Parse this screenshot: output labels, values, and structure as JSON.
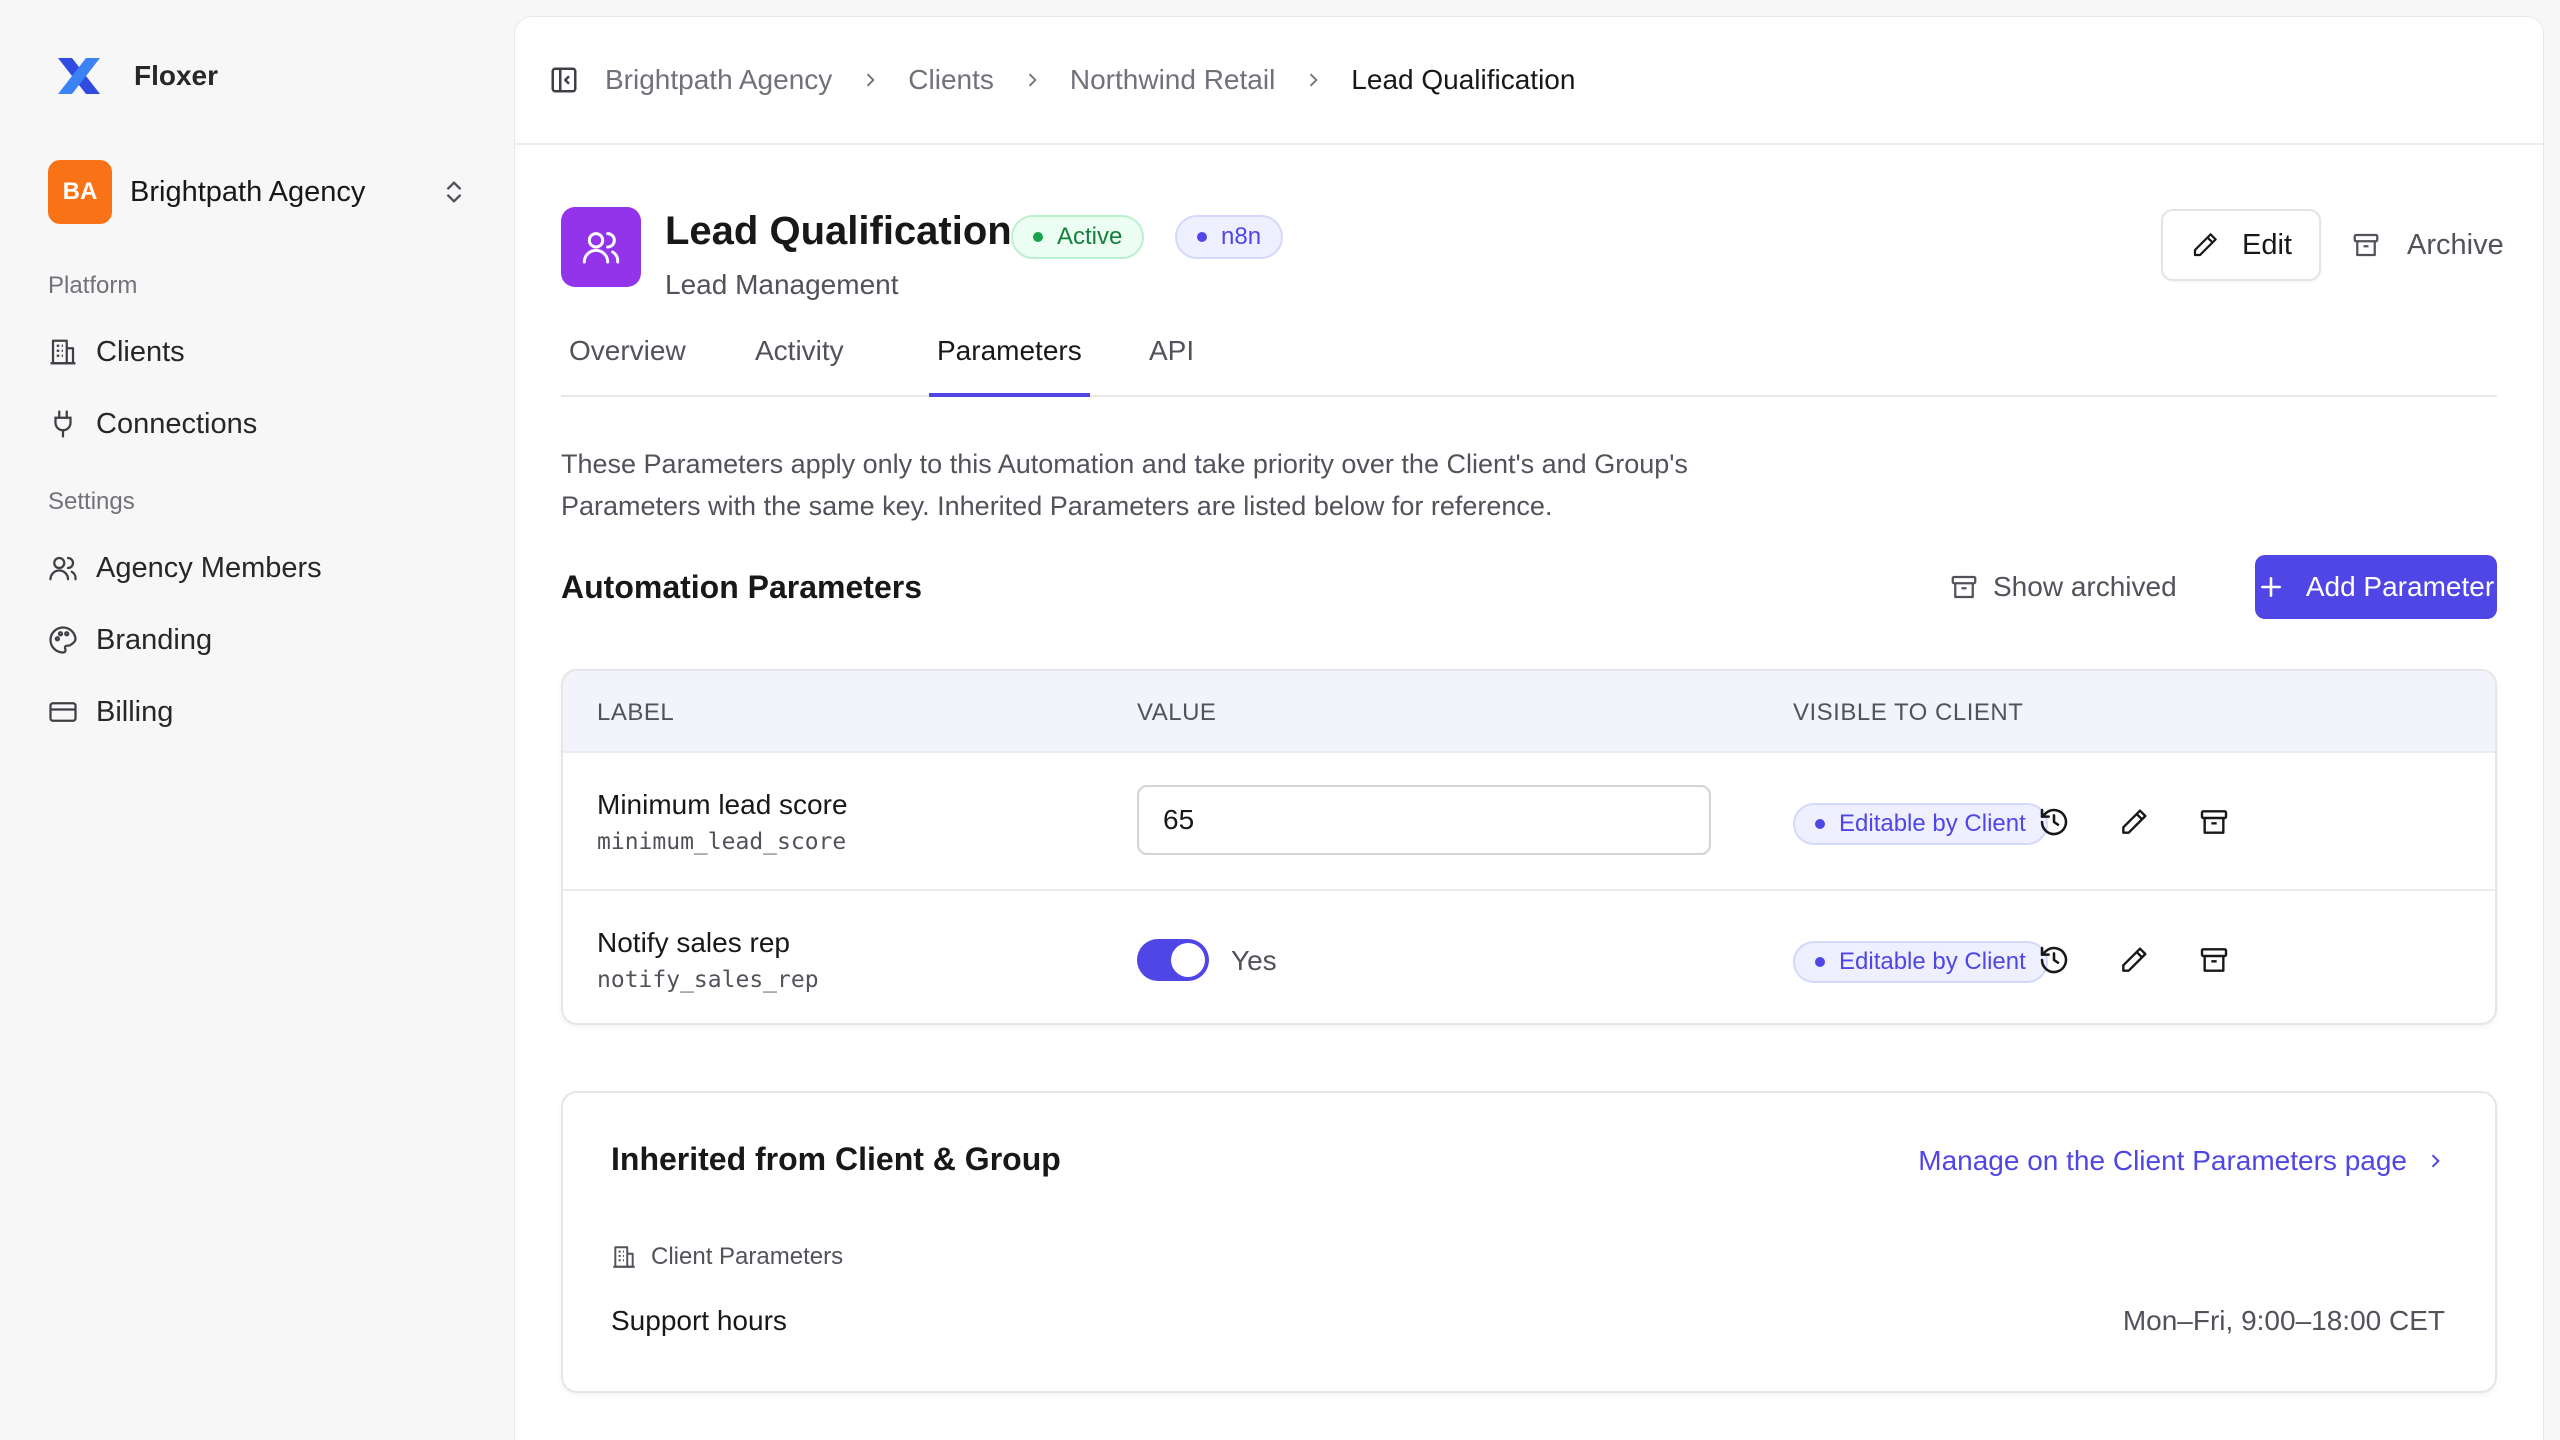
{
  "app": {
    "name": "Floxer"
  },
  "org": {
    "initials": "BA",
    "name": "Brightpath Agency",
    "avatar_color": "#f97316"
  },
  "sidebar": {
    "sections": [
      {
        "label": "Platform",
        "items": [
          {
            "label": "Clients",
            "icon": "building-icon"
          },
          {
            "label": "Connections",
            "icon": "plug-icon"
          }
        ]
      },
      {
        "label": "Settings",
        "items": [
          {
            "label": "Agency Members",
            "icon": "users-icon"
          },
          {
            "label": "Branding",
            "icon": "palette-icon"
          },
          {
            "label": "Billing",
            "icon": "credit-card-icon"
          }
        ]
      }
    ]
  },
  "breadcrumb": [
    "Brightpath Agency",
    "Clients",
    "Northwind Retail",
    "Lead Qualification"
  ],
  "automation": {
    "title": "Lead Qualification",
    "subtitle": "Lead Management",
    "status": "Active",
    "platform": "n8n",
    "icon_color": "#9333ea",
    "edit_label": "Edit",
    "archive_label": "Archive"
  },
  "tabs": [
    {
      "label": "Overview",
      "active": false
    },
    {
      "label": "Activity",
      "active": false
    },
    {
      "label": "Parameters",
      "active": true
    },
    {
      "label": "API",
      "active": false
    }
  ],
  "description": "These Parameters apply only to this Automation and take priority over the Client's and Group's Parameters with the same key. Inherited Parameters are listed below for reference.",
  "parameters": {
    "title": "Automation Parameters",
    "show_archived_label": "Show archived",
    "add_label": "Add Parameter",
    "columns": [
      "LABEL",
      "VALUE",
      "VISIBLE TO CLIENT"
    ],
    "rows": [
      {
        "label": "Minimum lead score",
        "key": "minimum_lead_score",
        "value": "65",
        "visibility": "Editable by Client"
      },
      {
        "label": "Notify sales rep",
        "key": "notify_sales_rep",
        "value": "Yes",
        "toggle_on": true,
        "visibility": "Editable by Client"
      }
    ]
  },
  "inherited": {
    "title": "Inherited from Client & Group",
    "manage_link": "Manage on the Client Parameters page",
    "group_label": "Client Parameters",
    "items": [
      {
        "label": "Support hours",
        "value": "Mon–Fri, 9:00–18:00 CET"
      }
    ]
  },
  "colors": {
    "accent": "#4f46e5",
    "success": "#16a34a",
    "brand_logo": "#2f4be0"
  }
}
